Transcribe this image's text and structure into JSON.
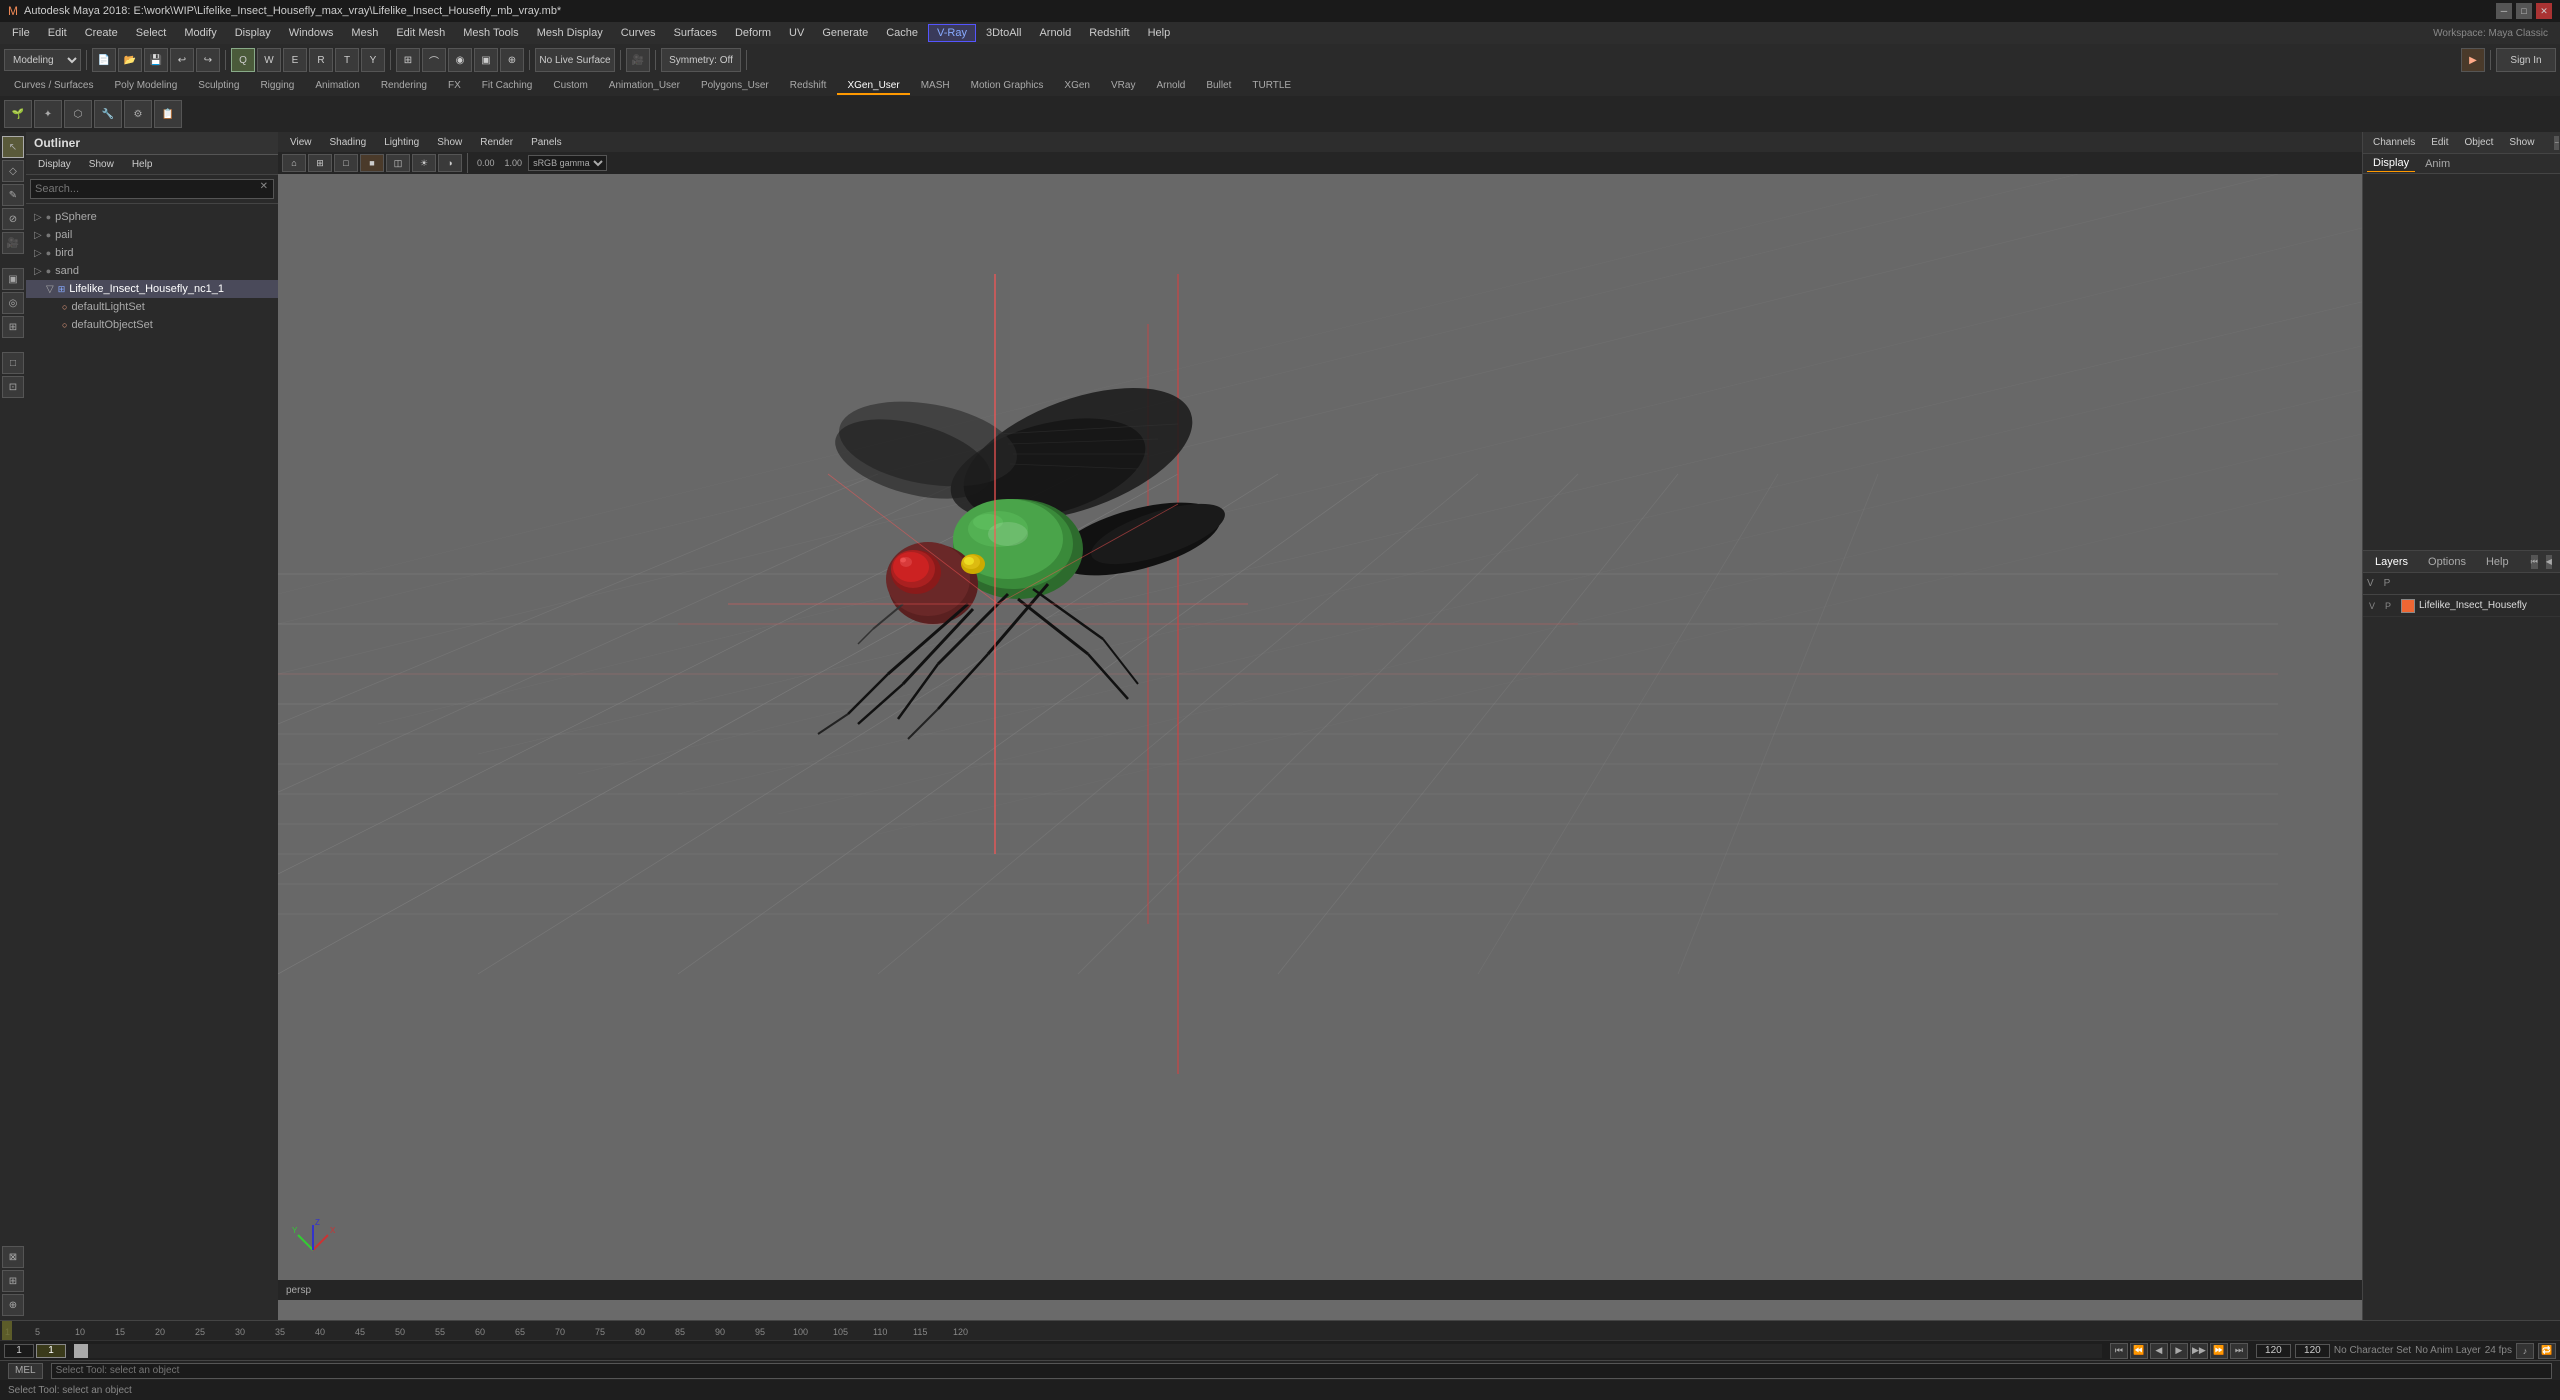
{
  "title": "Autodesk Maya 2018: E:\\work\\WIP\\Lifelike_Insect_Housefly_max_vray\\Lifelike_Insect_Housefly_mb_vray.mb*",
  "menus": {
    "items": [
      "File",
      "Edit",
      "Create",
      "Select",
      "Modify",
      "Display",
      "Windows",
      "Mesh",
      "Edit Mesh",
      "Mesh Tools",
      "Mesh Display",
      "Curves",
      "Surfaces",
      "Deform",
      "UV",
      "Generate",
      "Cache",
      "V-Ray",
      "3DtoAll",
      "Arnold",
      "Redshift",
      "Help"
    ]
  },
  "toolbar": {
    "mode_dropdown": "Modeling",
    "no_live_surface": "No Live Surface",
    "symmetry": "Symmetry: Off",
    "sign_in": "Sign In"
  },
  "shelf_tabs": [
    "Curves / Surfaces",
    "Poly Modeling",
    "Sculpting",
    "Rigging",
    "Animation",
    "Rendering",
    "FX",
    "Fit Caching",
    "Custom",
    "Animation_User",
    "Polygons_User",
    "Redshift",
    "XGen_User",
    "MASH",
    "Motion Graphics",
    "XGen",
    "VRay",
    "Arnold",
    "Bullet",
    "TURTLE"
  ],
  "shelf_active_tab": "XGen_User",
  "outliner": {
    "title": "Outliner",
    "menu_items": [
      "Display",
      "Show",
      "Help"
    ],
    "search_placeholder": "Search...",
    "items": [
      {
        "name": "pSphere",
        "indent": 0,
        "icon": "▷",
        "type": "mesh"
      },
      {
        "name": "pail",
        "indent": 0,
        "icon": "▷",
        "type": "mesh"
      },
      {
        "name": "bird",
        "indent": 0,
        "icon": "▷",
        "type": "mesh"
      },
      {
        "name": "sand",
        "indent": 0,
        "icon": "▷",
        "type": "mesh"
      },
      {
        "name": "Lifelike_Insect_Housefly_nc1_1",
        "indent": 1,
        "icon": "▽",
        "type": "group",
        "expanded": true
      },
      {
        "name": "defaultLightSet",
        "indent": 2,
        "icon": "○",
        "type": "light"
      },
      {
        "name": "defaultObjectSet",
        "indent": 2,
        "icon": "○",
        "type": "object"
      }
    ]
  },
  "viewport": {
    "menu_items": [
      "View",
      "Shading",
      "Lighting",
      "Show",
      "Render",
      "Panels"
    ],
    "label": "persp",
    "gamma_label": "sRGB gamma",
    "gamma_value": "0.00",
    "gamma_scale": "1.00"
  },
  "right_panel": {
    "header_items": [
      "Channels",
      "Edit",
      "Object",
      "Show"
    ],
    "tabs": [
      "Display",
      "Anim"
    ],
    "layer_tabs": [
      "Layers",
      "Options",
      "Help"
    ],
    "layer_item": "Lifelike_Insect_Housefly"
  },
  "timeline": {
    "start": "1",
    "end": "120",
    "current": "1",
    "range_start": "1",
    "range_end": "120",
    "fps": "24 fps"
  },
  "status_bar": {
    "mode": "MEL",
    "message": "Select Tool: select an object",
    "no_character_set": "No Character Set",
    "no_anim_layer": "No Anim Layer",
    "fps": "24 fps"
  }
}
